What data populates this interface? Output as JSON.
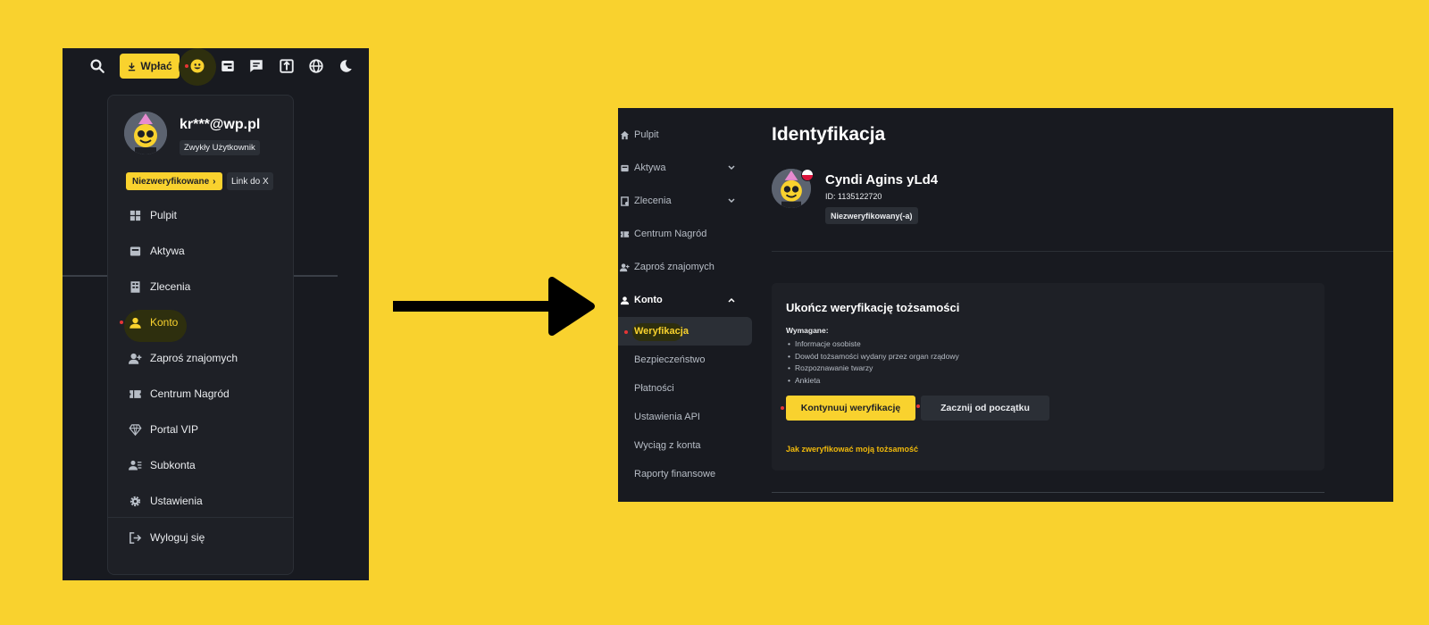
{
  "left": {
    "topbar": {
      "deposit_label": "Wpłać",
      "icons": [
        "search-icon",
        "download-icon",
        "profile-icon",
        "wallet-icon",
        "message-icon",
        "transfer-icon",
        "globe-icon",
        "moon-icon"
      ]
    },
    "dropdown": {
      "email": "kr***@wp.pl",
      "role": "Zwykły Użytkownik",
      "unverified_label": "Niezweryfikowane",
      "link_x_label": "Link do X",
      "items": [
        {
          "label": "Pulpit",
          "icon": "dashboard-icon"
        },
        {
          "label": "Aktywa",
          "icon": "wallet-icon"
        },
        {
          "label": "Zlecenia",
          "icon": "orders-icon"
        },
        {
          "label": "Konto",
          "icon": "user-icon"
        },
        {
          "label": "Zaproś znajomych",
          "icon": "add-user-icon"
        },
        {
          "label": "Centrum Nagród",
          "icon": "ticket-icon"
        },
        {
          "label": "Portal VIP",
          "icon": "diamond-icon"
        },
        {
          "label": "Subkonta",
          "icon": "subaccount-icon"
        },
        {
          "label": "Ustawienia",
          "icon": "gear-icon"
        },
        {
          "label": "Wyloguj się",
          "icon": "logout-icon"
        }
      ]
    }
  },
  "right": {
    "sidebar": {
      "items": [
        {
          "label": "Pulpit",
          "icon": "home-icon"
        },
        {
          "label": "Aktywa",
          "icon": "wallet-icon"
        },
        {
          "label": "Zlecenia",
          "icon": "orders-icon"
        },
        {
          "label": "Centrum Nagród",
          "icon": "ticket-icon"
        },
        {
          "label": "Zaproś znajomych",
          "icon": "add-user-icon"
        },
        {
          "label": "Konto",
          "icon": "user-icon"
        }
      ],
      "sub_items": [
        {
          "label": "Weryfikacja"
        },
        {
          "label": "Bezpieczeństwo"
        },
        {
          "label": "Płatności"
        },
        {
          "label": "Ustawienia API"
        },
        {
          "label": "Wyciąg z konta"
        },
        {
          "label": "Raporty finansowe"
        }
      ]
    },
    "page_title": "Identyfikacja",
    "profile": {
      "name": "Cyndi Agins yLd4",
      "id_text": "ID: 1135122720",
      "status": "Niezweryfikowany(-a)"
    },
    "card": {
      "title": "Ukończ weryfikację tożsamości",
      "required_label": "Wymagane:",
      "requirements": [
        "Informacje osobiste",
        "Dowód tożsamości wydany przez organ rządowy",
        "Rozpoznawanie twarzy",
        "Ankieta"
      ],
      "continue_label": "Kontynuuj weryfikację",
      "restart_label": "Zacznij od początku",
      "help_link": "Jak zweryfikować moją tożsamość"
    }
  },
  "colors": {
    "background": "#f9d22e",
    "panel": "#181a20",
    "card": "#1e2026",
    "accent": "#f9d22e",
    "link": "#f0b90b"
  }
}
